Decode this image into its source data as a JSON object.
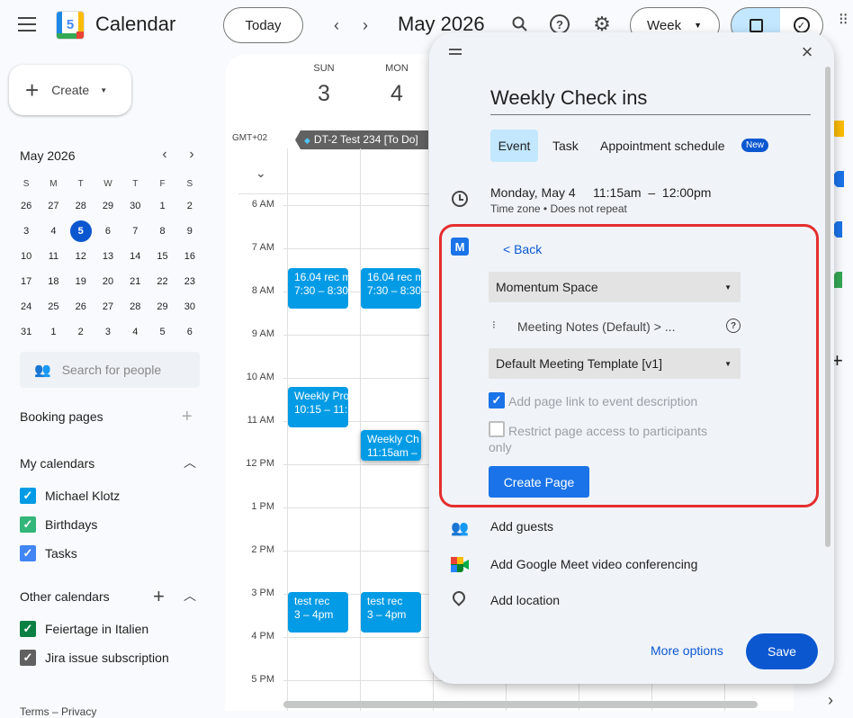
{
  "header": {
    "app_title": "Calendar",
    "logo_number": "5",
    "today_button": "Today",
    "current_period": "May 2026",
    "view_selector": "Week"
  },
  "sidebar": {
    "create_label": "Create",
    "mini_calendar": {
      "title": "May 2026",
      "weekdays": [
        "S",
        "M",
        "T",
        "W",
        "T",
        "F",
        "S"
      ],
      "weeks": [
        [
          "26",
          "27",
          "28",
          "29",
          "30",
          "1",
          "2"
        ],
        [
          "3",
          "4",
          "5",
          "6",
          "7",
          "8",
          "9"
        ],
        [
          "10",
          "11",
          "12",
          "13",
          "14",
          "15",
          "16"
        ],
        [
          "17",
          "18",
          "19",
          "20",
          "21",
          "22",
          "23"
        ],
        [
          "24",
          "25",
          "26",
          "27",
          "28",
          "29",
          "30"
        ],
        [
          "31",
          "1",
          "2",
          "3",
          "4",
          "5",
          "6"
        ]
      ],
      "today": "5"
    },
    "search_people_placeholder": "Search for people",
    "booking_pages_label": "Booking pages",
    "my_calendars_label": "My calendars",
    "my_calendars": [
      {
        "name": "Michael Klotz",
        "color": "#039be5"
      },
      {
        "name": "Birthdays",
        "color": "#33b679"
      },
      {
        "name": "Tasks",
        "color": "#4285f4"
      }
    ],
    "other_calendars_label": "Other calendars",
    "other_calendars": [
      {
        "name": "Feiertage in Italien",
        "color": "#0b8043"
      },
      {
        "name": "Jira issue subscription",
        "color": "#616161"
      }
    ],
    "footer": "Terms – Privacy"
  },
  "grid": {
    "timezone": "GMT+02",
    "days": [
      {
        "dow": "SUN",
        "date": "3"
      },
      {
        "dow": "MON",
        "date": "4"
      }
    ],
    "all_day_event": "DT-2 Test 234 [To Do]",
    "hours": [
      "6 AM",
      "7 AM",
      "8 AM",
      "9 AM",
      "10 AM",
      "11 AM",
      "12 PM",
      "1 PM",
      "2 PM",
      "3 PM",
      "4 PM",
      "5 PM"
    ],
    "events": {
      "sun_rec_title": "16.04 rec m",
      "sun_rec_time": "7:30 – 8:30",
      "mon_rec_title": "16.04 rec m",
      "mon_rec_time": "7:30 – 8:30",
      "weekly_pro_title": "Weekly Pro",
      "weekly_pro_time": "10:15 – 11:1",
      "weekly_ch_title": "Weekly Ch",
      "weekly_ch_time": "11:15am –",
      "sun_test_title": "test rec",
      "sun_test_time": "3 – 4pm",
      "mon_test_title": "test rec",
      "mon_test_time": "3 – 4pm"
    }
  },
  "popup": {
    "title": "Weekly Check ins",
    "tabs": [
      "Event",
      "Task",
      "Appointment schedule"
    ],
    "new_badge": "New",
    "date_time": "Monday, May 4     11:15am  –  12:00pm",
    "timezone_repeat": "Time zone • Does not repeat",
    "back_label": "< Back",
    "space_select": "Momentum Space",
    "notes_path": "Meeting Notes (Default) > ...",
    "template_select": "Default Meeting Template [v1]",
    "add_link_label": "Add page link to event description",
    "add_link_checked": true,
    "restrict_label": "Restrict page access to participants only",
    "restrict_checked": false,
    "create_page_button": "Create Page",
    "add_guests": "Add guests",
    "add_meet": "Add Google Meet video conferencing",
    "add_location": "Add location",
    "more_options": "More options",
    "save": "Save"
  }
}
